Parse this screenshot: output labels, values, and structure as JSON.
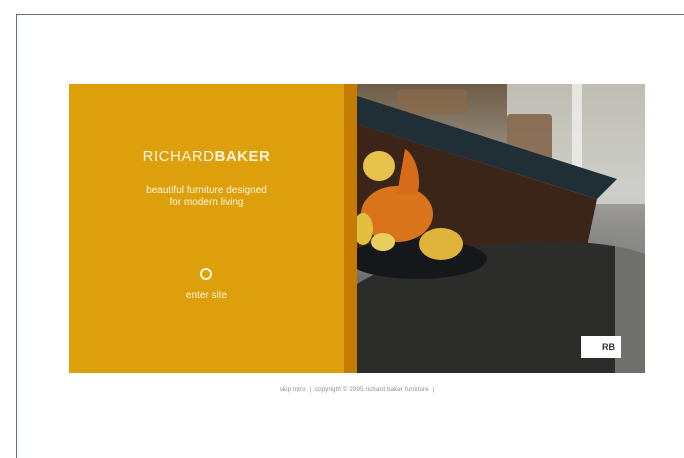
{
  "brand": {
    "name_light": "RICHARD",
    "name_bold": "BAKER"
  },
  "intro": {
    "tagline_line1": "beautiful furniture designed",
    "tagline_line2": "for modern living",
    "enter_label": "enter site",
    "enter_icon": "circle-icon",
    "badge": "RB"
  },
  "footer": {
    "skip_intro": "skip intro",
    "separator": "|",
    "copyright": "copyright © 2005 richard baker furniture"
  },
  "colors": {
    "panel": "#dd9f0b",
    "strip": "#c47c00",
    "frame": "#5d6f7e"
  }
}
